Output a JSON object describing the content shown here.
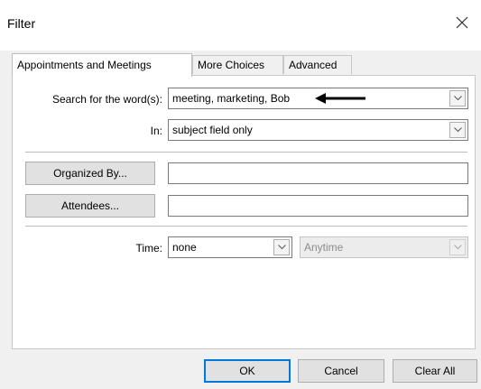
{
  "window": {
    "title": "Filter"
  },
  "tabs": [
    {
      "label": "Appointments and Meetings",
      "active": true
    },
    {
      "label": "More Choices",
      "active": false
    },
    {
      "label": "Advanced",
      "active": false
    }
  ],
  "search": {
    "label": "Search for the word(s):",
    "value": "meeting, marketing, Bob"
  },
  "in_field": {
    "label": "In:",
    "value": "subject field only"
  },
  "organized_by": {
    "button_label": "Organized By...",
    "value": ""
  },
  "attendees": {
    "button_label": "Attendees...",
    "value": ""
  },
  "time": {
    "label": "Time:",
    "value": "none",
    "range_value": "Anytime"
  },
  "buttons": {
    "ok": "OK",
    "cancel": "Cancel",
    "clear_all": "Clear All"
  },
  "icons": {
    "close": "close-icon",
    "dropdown": "chevron-down-icon",
    "annotation": "arrow-left-icon"
  },
  "colors": {
    "default_button_border": "#0078d7",
    "annotation_arrow": "#000000"
  }
}
